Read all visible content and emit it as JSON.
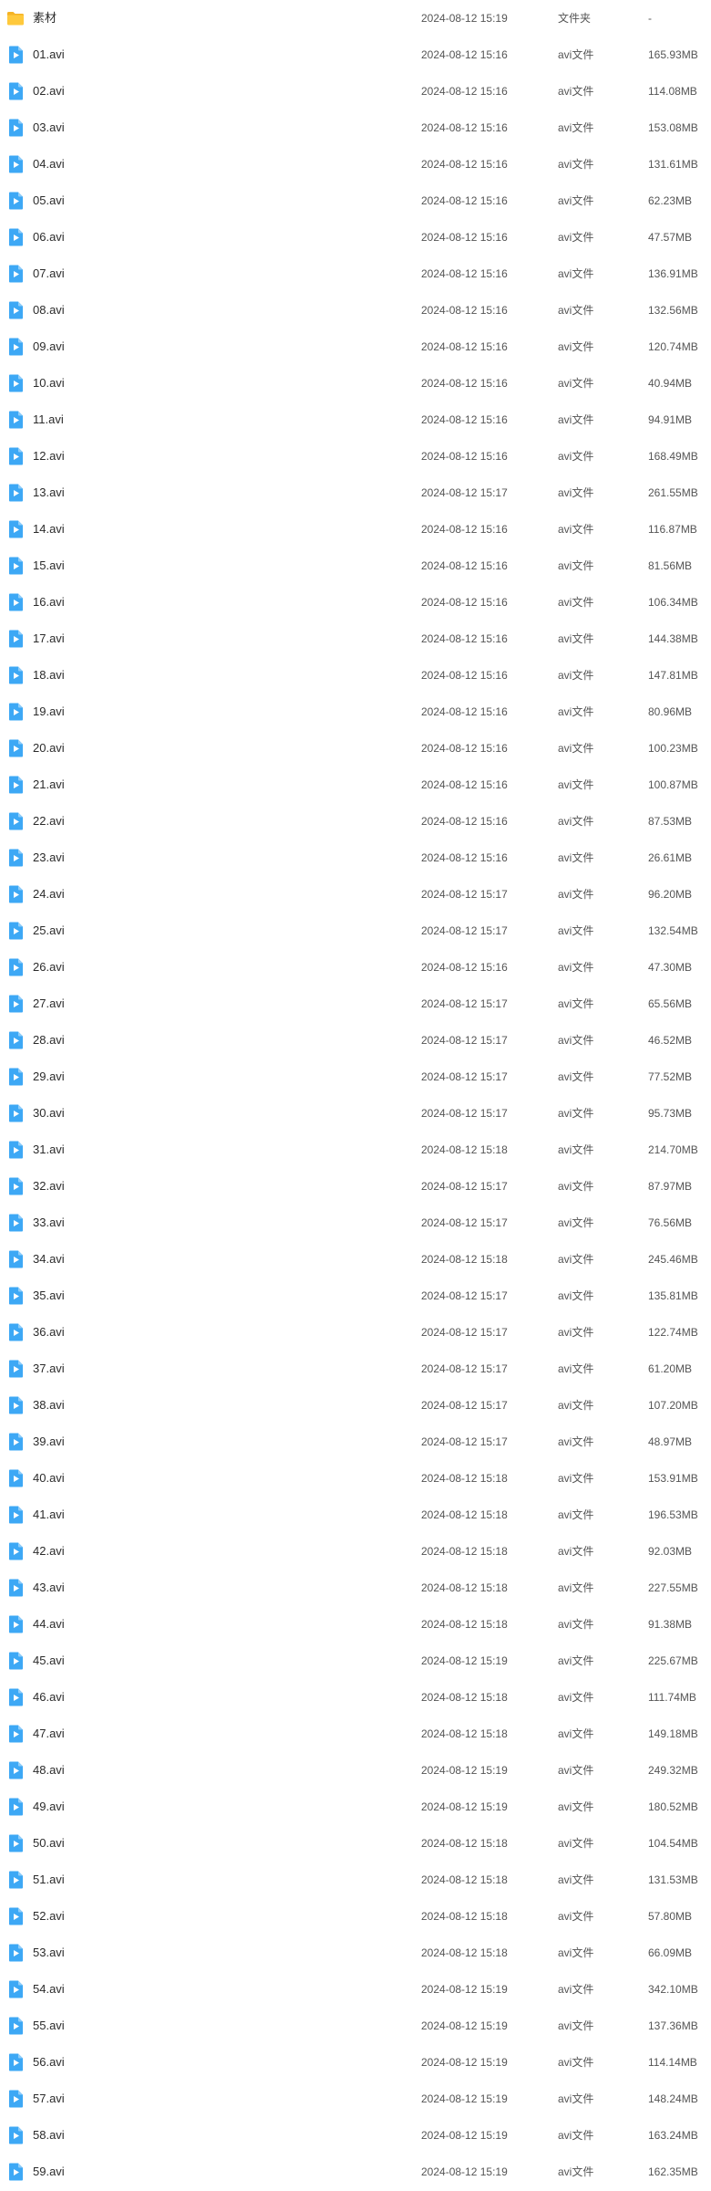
{
  "colors": {
    "folder_icon": "#ffc93c",
    "folder_icon_tab": "#f5b324",
    "video_icon": "#3da8f5",
    "text": "#2b2b2b",
    "meta_text": "#555555"
  },
  "files": [
    {
      "name": "素材",
      "modified": "2024-08-12 15:19",
      "type": "文件夹",
      "size": "-",
      "icon": "folder-icon"
    },
    {
      "name": "01.avi",
      "modified": "2024-08-12 15:16",
      "type": "avi文件",
      "size": "165.93MB",
      "icon": "video-file-icon"
    },
    {
      "name": "02.avi",
      "modified": "2024-08-12 15:16",
      "type": "avi文件",
      "size": "114.08MB",
      "icon": "video-file-icon"
    },
    {
      "name": "03.avi",
      "modified": "2024-08-12 15:16",
      "type": "avi文件",
      "size": "153.08MB",
      "icon": "video-file-icon"
    },
    {
      "name": "04.avi",
      "modified": "2024-08-12 15:16",
      "type": "avi文件",
      "size": "131.61MB",
      "icon": "video-file-icon"
    },
    {
      "name": "05.avi",
      "modified": "2024-08-12 15:16",
      "type": "avi文件",
      "size": "62.23MB",
      "icon": "video-file-icon"
    },
    {
      "name": "06.avi",
      "modified": "2024-08-12 15:16",
      "type": "avi文件",
      "size": "47.57MB",
      "icon": "video-file-icon"
    },
    {
      "name": "07.avi",
      "modified": "2024-08-12 15:16",
      "type": "avi文件",
      "size": "136.91MB",
      "icon": "video-file-icon"
    },
    {
      "name": "08.avi",
      "modified": "2024-08-12 15:16",
      "type": "avi文件",
      "size": "132.56MB",
      "icon": "video-file-icon"
    },
    {
      "name": "09.avi",
      "modified": "2024-08-12 15:16",
      "type": "avi文件",
      "size": "120.74MB",
      "icon": "video-file-icon"
    },
    {
      "name": "10.avi",
      "modified": "2024-08-12 15:16",
      "type": "avi文件",
      "size": "40.94MB",
      "icon": "video-file-icon"
    },
    {
      "name": "11.avi",
      "modified": "2024-08-12 15:16",
      "type": "avi文件",
      "size": "94.91MB",
      "icon": "video-file-icon"
    },
    {
      "name": "12.avi",
      "modified": "2024-08-12 15:16",
      "type": "avi文件",
      "size": "168.49MB",
      "icon": "video-file-icon"
    },
    {
      "name": "13.avi",
      "modified": "2024-08-12 15:17",
      "type": "avi文件",
      "size": "261.55MB",
      "icon": "video-file-icon"
    },
    {
      "name": "14.avi",
      "modified": "2024-08-12 15:16",
      "type": "avi文件",
      "size": "116.87MB",
      "icon": "video-file-icon"
    },
    {
      "name": "15.avi",
      "modified": "2024-08-12 15:16",
      "type": "avi文件",
      "size": "81.56MB",
      "icon": "video-file-icon"
    },
    {
      "name": "16.avi",
      "modified": "2024-08-12 15:16",
      "type": "avi文件",
      "size": "106.34MB",
      "icon": "video-file-icon"
    },
    {
      "name": "17.avi",
      "modified": "2024-08-12 15:16",
      "type": "avi文件",
      "size": "144.38MB",
      "icon": "video-file-icon"
    },
    {
      "name": "18.avi",
      "modified": "2024-08-12 15:16",
      "type": "avi文件",
      "size": "147.81MB",
      "icon": "video-file-icon"
    },
    {
      "name": "19.avi",
      "modified": "2024-08-12 15:16",
      "type": "avi文件",
      "size": "80.96MB",
      "icon": "video-file-icon"
    },
    {
      "name": "20.avi",
      "modified": "2024-08-12 15:16",
      "type": "avi文件",
      "size": "100.23MB",
      "icon": "video-file-icon"
    },
    {
      "name": "21.avi",
      "modified": "2024-08-12 15:16",
      "type": "avi文件",
      "size": "100.87MB",
      "icon": "video-file-icon"
    },
    {
      "name": "22.avi",
      "modified": "2024-08-12 15:16",
      "type": "avi文件",
      "size": "87.53MB",
      "icon": "video-file-icon"
    },
    {
      "name": "23.avi",
      "modified": "2024-08-12 15:16",
      "type": "avi文件",
      "size": "26.61MB",
      "icon": "video-file-icon"
    },
    {
      "name": "24.avi",
      "modified": "2024-08-12 15:17",
      "type": "avi文件",
      "size": "96.20MB",
      "icon": "video-file-icon"
    },
    {
      "name": "25.avi",
      "modified": "2024-08-12 15:17",
      "type": "avi文件",
      "size": "132.54MB",
      "icon": "video-file-icon"
    },
    {
      "name": "26.avi",
      "modified": "2024-08-12 15:16",
      "type": "avi文件",
      "size": "47.30MB",
      "icon": "video-file-icon"
    },
    {
      "name": "27.avi",
      "modified": "2024-08-12 15:17",
      "type": "avi文件",
      "size": "65.56MB",
      "icon": "video-file-icon"
    },
    {
      "name": "28.avi",
      "modified": "2024-08-12 15:17",
      "type": "avi文件",
      "size": "46.52MB",
      "icon": "video-file-icon"
    },
    {
      "name": "29.avi",
      "modified": "2024-08-12 15:17",
      "type": "avi文件",
      "size": "77.52MB",
      "icon": "video-file-icon"
    },
    {
      "name": "30.avi",
      "modified": "2024-08-12 15:17",
      "type": "avi文件",
      "size": "95.73MB",
      "icon": "video-file-icon"
    },
    {
      "name": "31.avi",
      "modified": "2024-08-12 15:18",
      "type": "avi文件",
      "size": "214.70MB",
      "icon": "video-file-icon"
    },
    {
      "name": "32.avi",
      "modified": "2024-08-12 15:17",
      "type": "avi文件",
      "size": "87.97MB",
      "icon": "video-file-icon"
    },
    {
      "name": "33.avi",
      "modified": "2024-08-12 15:17",
      "type": "avi文件",
      "size": "76.56MB",
      "icon": "video-file-icon"
    },
    {
      "name": "34.avi",
      "modified": "2024-08-12 15:18",
      "type": "avi文件",
      "size": "245.46MB",
      "icon": "video-file-icon"
    },
    {
      "name": "35.avi",
      "modified": "2024-08-12 15:17",
      "type": "avi文件",
      "size": "135.81MB",
      "icon": "video-file-icon"
    },
    {
      "name": "36.avi",
      "modified": "2024-08-12 15:17",
      "type": "avi文件",
      "size": "122.74MB",
      "icon": "video-file-icon"
    },
    {
      "name": "37.avi",
      "modified": "2024-08-12 15:17",
      "type": "avi文件",
      "size": "61.20MB",
      "icon": "video-file-icon"
    },
    {
      "name": "38.avi",
      "modified": "2024-08-12 15:17",
      "type": "avi文件",
      "size": "107.20MB",
      "icon": "video-file-icon"
    },
    {
      "name": "39.avi",
      "modified": "2024-08-12 15:17",
      "type": "avi文件",
      "size": "48.97MB",
      "icon": "video-file-icon"
    },
    {
      "name": "40.avi",
      "modified": "2024-08-12 15:18",
      "type": "avi文件",
      "size": "153.91MB",
      "icon": "video-file-icon"
    },
    {
      "name": "41.avi",
      "modified": "2024-08-12 15:18",
      "type": "avi文件",
      "size": "196.53MB",
      "icon": "video-file-icon"
    },
    {
      "name": "42.avi",
      "modified": "2024-08-12 15:18",
      "type": "avi文件",
      "size": "92.03MB",
      "icon": "video-file-icon"
    },
    {
      "name": "43.avi",
      "modified": "2024-08-12 15:18",
      "type": "avi文件",
      "size": "227.55MB",
      "icon": "video-file-icon"
    },
    {
      "name": "44.avi",
      "modified": "2024-08-12 15:18",
      "type": "avi文件",
      "size": "91.38MB",
      "icon": "video-file-icon"
    },
    {
      "name": "45.avi",
      "modified": "2024-08-12 15:19",
      "type": "avi文件",
      "size": "225.67MB",
      "icon": "video-file-icon"
    },
    {
      "name": "46.avi",
      "modified": "2024-08-12 15:18",
      "type": "avi文件",
      "size": "111.74MB",
      "icon": "video-file-icon"
    },
    {
      "name": "47.avi",
      "modified": "2024-08-12 15:18",
      "type": "avi文件",
      "size": "149.18MB",
      "icon": "video-file-icon"
    },
    {
      "name": "48.avi",
      "modified": "2024-08-12 15:19",
      "type": "avi文件",
      "size": "249.32MB",
      "icon": "video-file-icon"
    },
    {
      "name": "49.avi",
      "modified": "2024-08-12 15:19",
      "type": "avi文件",
      "size": "180.52MB",
      "icon": "video-file-icon"
    },
    {
      "name": "50.avi",
      "modified": "2024-08-12 15:18",
      "type": "avi文件",
      "size": "104.54MB",
      "icon": "video-file-icon"
    },
    {
      "name": "51.avi",
      "modified": "2024-08-12 15:18",
      "type": "avi文件",
      "size": "131.53MB",
      "icon": "video-file-icon"
    },
    {
      "name": "52.avi",
      "modified": "2024-08-12 15:18",
      "type": "avi文件",
      "size": "57.80MB",
      "icon": "video-file-icon"
    },
    {
      "name": "53.avi",
      "modified": "2024-08-12 15:18",
      "type": "avi文件",
      "size": "66.09MB",
      "icon": "video-file-icon"
    },
    {
      "name": "54.avi",
      "modified": "2024-08-12 15:19",
      "type": "avi文件",
      "size": "342.10MB",
      "icon": "video-file-icon"
    },
    {
      "name": "55.avi",
      "modified": "2024-08-12 15:19",
      "type": "avi文件",
      "size": "137.36MB",
      "icon": "video-file-icon"
    },
    {
      "name": "56.avi",
      "modified": "2024-08-12 15:19",
      "type": "avi文件",
      "size": "114.14MB",
      "icon": "video-file-icon"
    },
    {
      "name": "57.avi",
      "modified": "2024-08-12 15:19",
      "type": "avi文件",
      "size": "148.24MB",
      "icon": "video-file-icon"
    },
    {
      "name": "58.avi",
      "modified": "2024-08-12 15:19",
      "type": "avi文件",
      "size": "163.24MB",
      "icon": "video-file-icon"
    },
    {
      "name": "59.avi",
      "modified": "2024-08-12 15:19",
      "type": "avi文件",
      "size": "162.35MB",
      "icon": "video-file-icon"
    }
  ]
}
